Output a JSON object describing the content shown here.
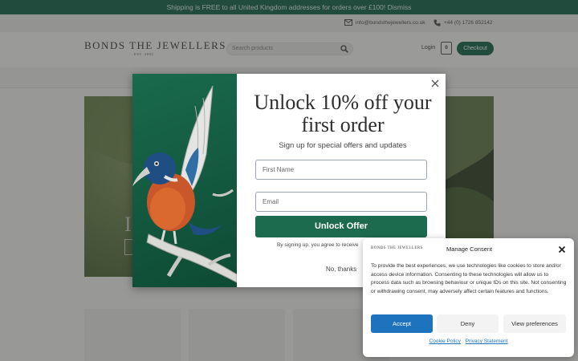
{
  "announcement": {
    "text": "Shipping is FREE to all United Kingdom addresses for orders over £100! Dismiss"
  },
  "contact": {
    "email": "info@bondsthejewellers.co.uk",
    "phone": "+44 (0) 1726 852142",
    "email_icon": "mail-icon",
    "phone_icon": "phone-icon"
  },
  "header": {
    "logo_text": "BONDS THE JEWELLERS",
    "logo_sub": "EST. 2002",
    "search_placeholder": "Search products",
    "login_label": "Login",
    "cart_count": "0",
    "checkout_label": "Checkout"
  },
  "hero": {
    "partial_letter": "I"
  },
  "popup": {
    "title": "Unlock 10% off your first order",
    "subtitle": "Sign up for special offers and updates",
    "first_name_placeholder": "First Name",
    "email_placeholder": "Email",
    "submit_label": "Unlock Offer",
    "disclaimer": "By signing up, you agree to receive",
    "decline_label": "No, thanks"
  },
  "consent": {
    "title": "Manage Consent",
    "logo_text": "BONDS THE JEWELLERS",
    "body": "To provide the best experiences, we use technologies like cookies to store and/or access device information. Consenting to these technologies will allow us to process data such as browsing behaviour or unique IDs on this site. Not consenting or withdrawing consent, may adversely affect certain features and functions.",
    "accept_label": "Accept",
    "deny_label": "Deny",
    "preferences_label": "View preferences",
    "cookie_policy_label": "Cookie Policy",
    "privacy_label": "Privacy Statement"
  },
  "colors": {
    "brand_green": "#1d6b4f",
    "accept_blue": "#1e73be"
  }
}
